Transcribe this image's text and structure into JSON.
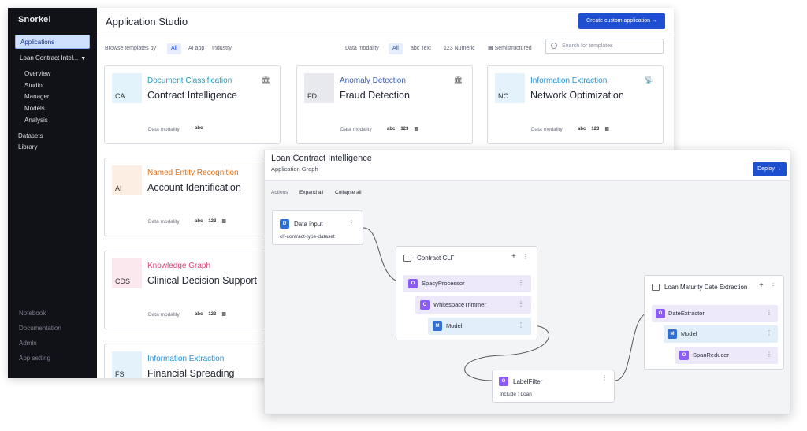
{
  "sidebar": {
    "logo": "Snorkel",
    "applications": "Applications",
    "current_app": "Loan Contract Intel...",
    "sub_items": [
      "Overview",
      "Studio",
      "Manager",
      "Models",
      "Analysis"
    ],
    "datasets": "Datasets",
    "library": "Library",
    "bottom_items": [
      "Notebook",
      "Documentation",
      "Admin",
      "App setting"
    ]
  },
  "header": {
    "title": "Application Studio",
    "create_button": "Create custom application →"
  },
  "filters": {
    "browse_label": "Browse templates by",
    "browse_options": [
      "All",
      "AI app",
      "Industry"
    ],
    "modality_label": "Data modality",
    "modality_options": [
      "All",
      "abc Text",
      "123 Numeric",
      "Semistructured"
    ],
    "search_placeholder": "Search for templates"
  },
  "cards": [
    {
      "abbr": "CA",
      "type": "Document Classification",
      "name": "Contract Intelligence",
      "modality_label": "Data modality",
      "modalities": [
        "abc"
      ],
      "type_color": "#2b9bb5",
      "badge_bg": "#e3f3fb"
    },
    {
      "abbr": "FD",
      "type": "Anomaly Detection",
      "name": "Fraud Detection",
      "modality_label": "Data modality",
      "modalities": [
        "abc",
        "123",
        "█"
      ],
      "type_color": "#3b5fa8",
      "badge_bg": "#e7e9ef"
    },
    {
      "abbr": "NO",
      "type": "Information Extraction",
      "name": "Network Optimization",
      "modality_label": "Data modality",
      "modalities": [
        "abc",
        "123",
        "█"
      ],
      "type_color": "#2b8fcf",
      "badge_bg": "#e3f2fb"
    },
    {
      "abbr": "AI",
      "type": "Named Entity Recognition",
      "name": "Account Identification",
      "modality_label": "Data modality",
      "modalities": [
        "abc",
        "123",
        "█"
      ],
      "type_color": "#e0731f",
      "badge_bg": "#fdeee3"
    },
    {
      "abbr": "CDS",
      "type": "Knowledge Graph",
      "name": "Clinical Decision Support",
      "modality_label": "Data modality",
      "modalities": [
        "abc",
        "123",
        "█"
      ],
      "type_color": "#d9477a",
      "badge_bg": "#fbe7ee"
    },
    {
      "abbr": "FS",
      "type": "Information Extraction",
      "name": "Financial Spreading",
      "modality_label": "",
      "modalities": [],
      "type_color": "#2b8fcf",
      "badge_bg": "#e3f2fb"
    }
  ],
  "graph": {
    "title": "Loan Contract Intelligence",
    "subtitle": "Application Graph",
    "deploy": "Deploy →",
    "actions_label": "Actions",
    "expand_all": "Expand all",
    "collapse_all": "Collapse all",
    "data_input": {
      "badge": "D",
      "title": "Data input",
      "dataset": "clf-contract-type-dataset"
    },
    "contract_clf": {
      "title": "Contract CLF",
      "spacy": "SpacyProcessor",
      "whitespace": "WhitespaceTrimmer",
      "model": "Model"
    },
    "label_filter": {
      "title": "LabelFilter",
      "include": "Include : Loan"
    },
    "loan_maturity": {
      "title": "Loan Maturity Date Extraction",
      "date_extractor": "DateExtractor",
      "model": "Model",
      "span_reducer": "SpanReducer"
    },
    "badges": {
      "operator": "O",
      "model": "M"
    }
  }
}
